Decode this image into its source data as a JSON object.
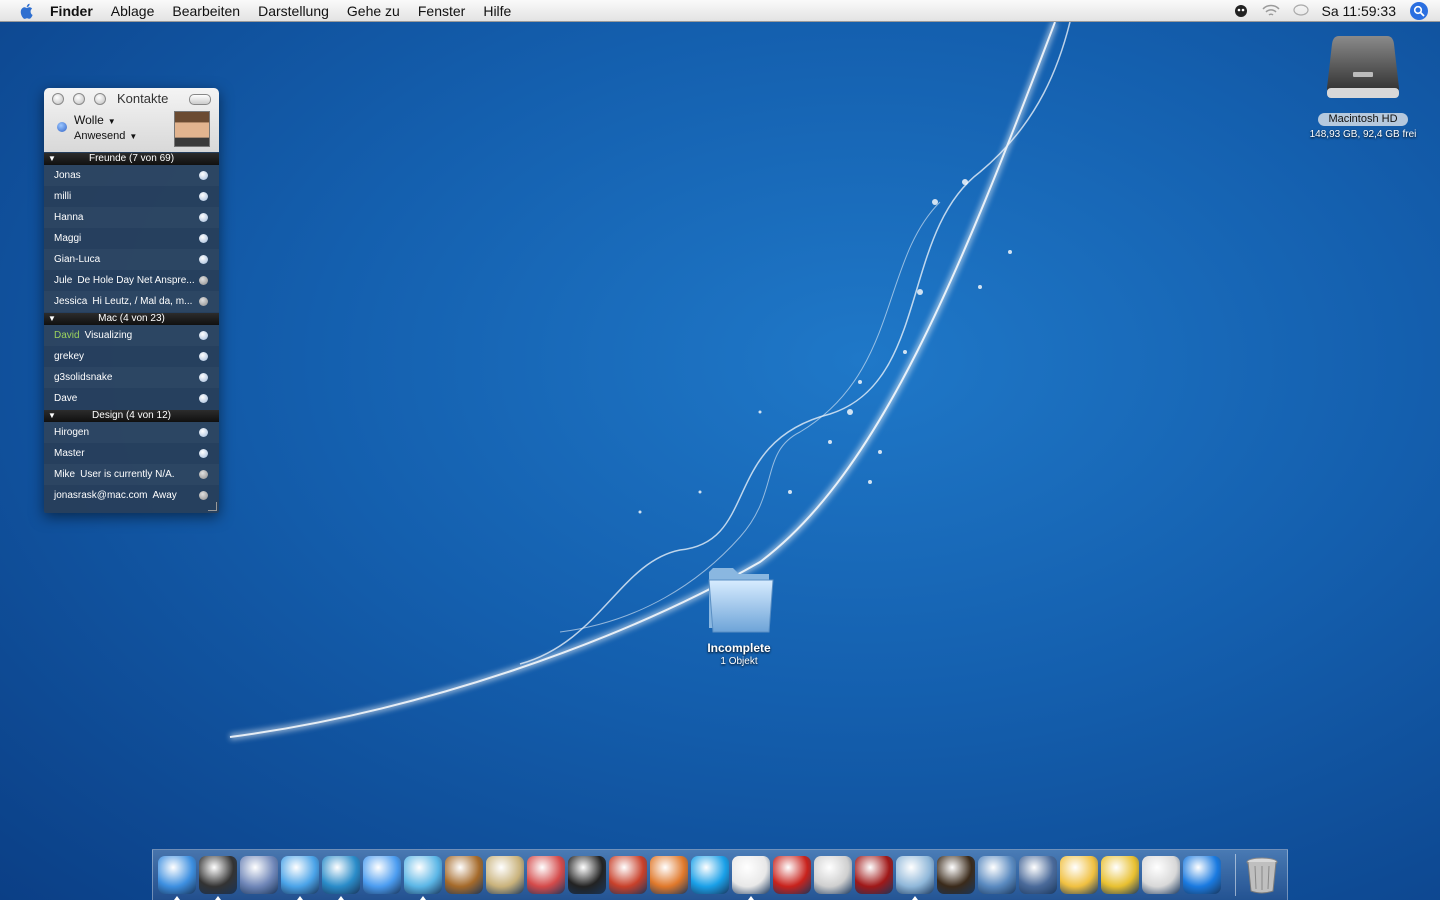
{
  "menubar": {
    "app": "Finder",
    "items": [
      "Ablage",
      "Bearbeiten",
      "Darstellung",
      "Gehe zu",
      "Fenster",
      "Hilfe"
    ],
    "clock": "Sa 11:59:33"
  },
  "contacts": {
    "title": "Kontakte",
    "user": "Wolle",
    "status": "Anwesend",
    "groups": [
      {
        "label": "Freunde (7 von 69)",
        "rows": [
          {
            "name": "Jonas",
            "msg": ""
          },
          {
            "name": "milli",
            "msg": ""
          },
          {
            "name": "Hanna",
            "msg": ""
          },
          {
            "name": "Maggi",
            "msg": ""
          },
          {
            "name": "Gian-Luca",
            "msg": ""
          },
          {
            "name": "Jule",
            "msg": "De Hole Day Net Anspre..."
          },
          {
            "name": "Jessica",
            "msg": "Hi Leutz, / Mal da, m..."
          }
        ]
      },
      {
        "label": "Mac (4 von 23)",
        "rows": [
          {
            "name": "David",
            "msg": "Visualizing"
          },
          {
            "name": "grekey",
            "msg": ""
          },
          {
            "name": "g3solidsnake",
            "msg": ""
          },
          {
            "name": "Dave",
            "msg": ""
          }
        ]
      },
      {
        "label": "Design (4 von 12)",
        "rows": [
          {
            "name": "Hirogen",
            "msg": ""
          },
          {
            "name": "Master",
            "msg": ""
          },
          {
            "name": "Mike",
            "msg": "User is currently N/A."
          },
          {
            "name": "jonasrask@mac.com",
            "msg": "Away"
          }
        ]
      }
    ]
  },
  "desktop": {
    "hd_name": "Macintosh HD",
    "hd_info": "148,93 GB, 92,4 GB frei",
    "folder_name": "Incomplete",
    "folder_info": "1 Objekt"
  },
  "dock": {
    "icons": [
      {
        "name": "finder-icon",
        "color": "#3d8fe0",
        "running": true
      },
      {
        "name": "dashboard-icon",
        "color": "#333333",
        "running": true
      },
      {
        "name": "mail-icon",
        "color": "#6f86b8",
        "running": false
      },
      {
        "name": "safari-icon",
        "color": "#4aa3e8",
        "running": true
      },
      {
        "name": "adium-icon",
        "color": "#2a8cc9",
        "running": true
      },
      {
        "name": "ichat-icon",
        "color": "#4b9cf0",
        "running": false
      },
      {
        "name": "itunes-icon",
        "color": "#5bb6e6",
        "running": true
      },
      {
        "name": "iphoto-icon",
        "color": "#a56a2a",
        "running": false
      },
      {
        "name": "transmit-icon",
        "color": "#c9b27b",
        "running": false
      },
      {
        "name": "cssedit-icon",
        "color": "#d44a4a",
        "running": false
      },
      {
        "name": "ink-drop-icon",
        "color": "#222222",
        "running": false
      },
      {
        "name": "hairdryer-icon",
        "color": "#c8402a",
        "running": false
      },
      {
        "name": "fish-icon",
        "color": "#e0782a",
        "running": false
      },
      {
        "name": "skype-icon",
        "color": "#1aa0e8",
        "running": false
      },
      {
        "name": "quill-icon",
        "color": "#e8e8e8",
        "running": true
      },
      {
        "name": "acrobat-icon",
        "color": "#c8221c",
        "running": false
      },
      {
        "name": "apple-box-icon",
        "color": "#cfcfcf",
        "running": false
      },
      {
        "name": "film-icon",
        "color": "#a01818",
        "running": false
      },
      {
        "name": "preview-icon",
        "color": "#8fb7d9",
        "running": true
      },
      {
        "name": "firefox-icon",
        "color": "#3a2a1a",
        "running": false
      },
      {
        "name": "xcode-icon",
        "color": "#5a8ac0",
        "running": false
      },
      {
        "name": "coffee-icon",
        "color": "#4a6a9a",
        "running": false
      },
      {
        "name": "delivery-icon",
        "color": "#f0c040",
        "running": false
      },
      {
        "name": "robot-icon",
        "color": "#e8c030",
        "running": false
      },
      {
        "name": "textedit-icon",
        "color": "#d8d8d8",
        "running": false
      },
      {
        "name": "quicktime-icon",
        "color": "#1a7ae0",
        "running": false
      }
    ]
  }
}
